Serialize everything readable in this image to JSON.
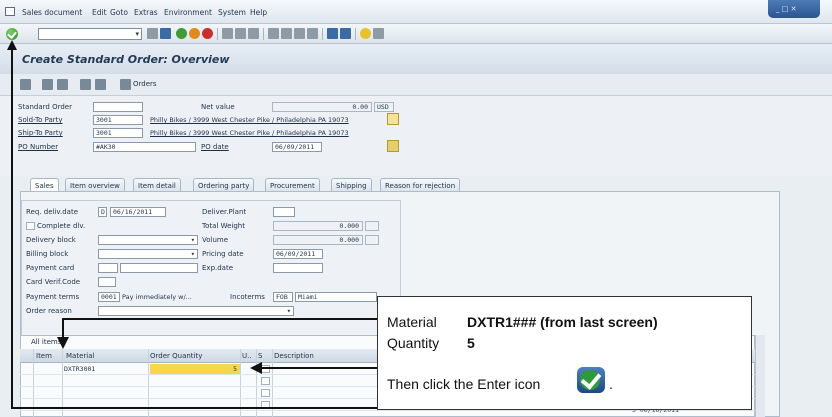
{
  "menu": [
    "Sales document",
    "Edit",
    "Goto",
    "Extras",
    "Environment",
    "System",
    "Help"
  ],
  "window_buttons": "_ □ ✕",
  "title": "Create Standard Order: Overview",
  "app_toolbar": {
    "orders_label": "Orders"
  },
  "header": {
    "standard_order_label": "Standard Order",
    "standard_order_value": "",
    "net_value_label": "Net value",
    "net_value": "0.00",
    "currency": "USD",
    "sold_to_label": "Sold-To Party",
    "sold_to_value": "3001",
    "sold_to_desc": "Philly Bikes / 3999 West Chester Pike / Philadelphia PA 19073",
    "ship_to_label": "Ship-To Party",
    "ship_to_value": "3001",
    "ship_to_desc": "Philly Bikes / 3999 West Chester Pike / Philadelphia PA 19073",
    "po_number_label": "PO Number",
    "po_number_value": "#AK30",
    "po_date_label": "PO date",
    "po_date_value": "06/09/2011"
  },
  "tabs": [
    "Sales",
    "Item overview",
    "Item detail",
    "Ordering party",
    "Procurement",
    "Shipping",
    "Reason for rejection"
  ],
  "sales_tab": {
    "req_deliv_date_label": "Req. deliv.date",
    "req_deliv_date_type": "D",
    "req_deliv_date_value": "06/16/2011",
    "deliver_plant_label": "Deliver.Plant",
    "complete_dlv_label": "Complete dlv.",
    "total_weight_label": "Total Weight",
    "total_weight_value": "0.000",
    "delivery_block_label": "Delivery block",
    "volume_label": "Volume",
    "volume_value": "0.000",
    "billing_block_label": "Billing block",
    "pricing_date_label": "Pricing date",
    "pricing_date_value": "06/09/2011",
    "payment_card_label": "Payment card",
    "exp_date_label": "Exp.date",
    "card_verif_label": "Card Verif.Code",
    "payment_terms_label": "Payment terms",
    "payment_terms_code": "0001",
    "payment_terms_desc": "Pay immediately w/...",
    "incoterms_label": "Incoterms",
    "incoterms_code": "FOB",
    "incoterms_place": "Miami",
    "order_reason_label": "Order reason"
  },
  "items_table": {
    "caption": "All items",
    "columns": [
      "Item",
      "Material",
      "Order Quantity",
      "U..",
      "S",
      "Description"
    ],
    "rows": [
      {
        "item": "",
        "material": "DXTR3001",
        "quantity": "5"
      }
    ],
    "footer_date": "3 06/16/2011"
  },
  "callout": {
    "material_label": "Material",
    "material_value": "DXTR1### (from last screen)",
    "quantity_label": "Quantity",
    "quantity_value": "5",
    "instruction": "Then click the Enter icon",
    "instruction_end": "."
  },
  "colors": {
    "title_text": "#223a55",
    "highlight_cell": "#f7d64a",
    "enter_green": "#2f9a3a"
  }
}
